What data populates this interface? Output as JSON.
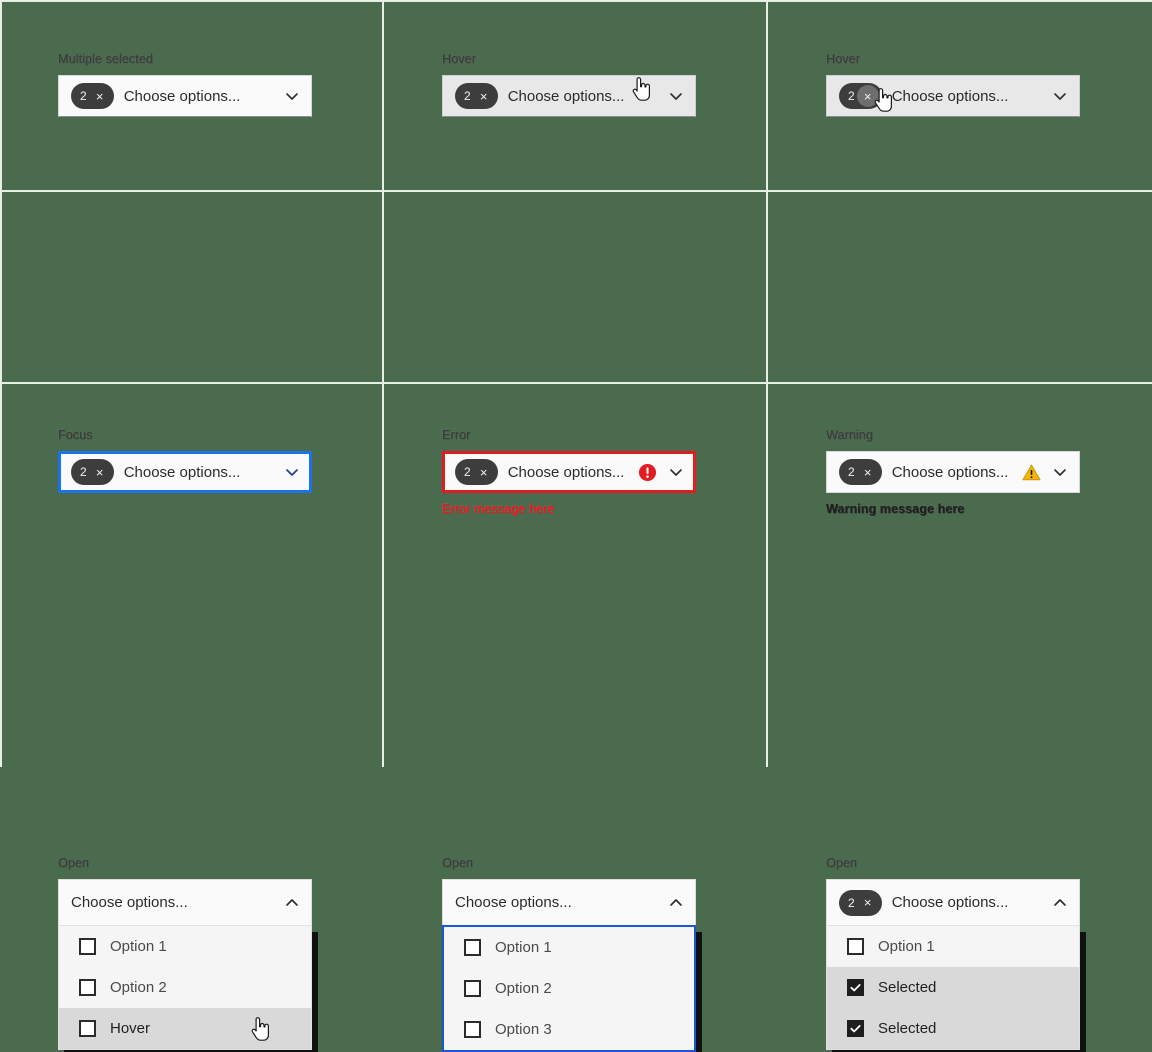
{
  "page": {
    "background_color": "#4a6b4e",
    "grid_line_color": "#e7efe7",
    "accent_focus": "#1a73e8",
    "accent_error": "#e11d22",
    "accent_warning": "#f5b60d",
    "chip_color": "#3d3d3d"
  },
  "common": {
    "placeholder": "Choose options...",
    "chip_count": "2",
    "chip_remove_glyph": "×",
    "chevron_down_icon": "chevron-down-icon",
    "chevron_up_icon": "chevron-up-icon"
  },
  "cells": [
    {
      "id": "multiple-selected",
      "label": "Multiple selected",
      "state": "default",
      "has_chip": true,
      "placeholder": "Choose options...",
      "chip_count": "2"
    },
    {
      "id": "hover-field",
      "label": "Hover",
      "state": "hover",
      "has_chip": true,
      "placeholder": "Choose options...",
      "chip_count": "2"
    },
    {
      "id": "hover-chip-remove",
      "label": "Hover",
      "state": "hover",
      "has_chip": true,
      "placeholder": "Choose options...",
      "chip_count": "2"
    },
    {
      "id": "focus",
      "label": "Focus",
      "state": "focus",
      "has_chip": true,
      "placeholder": "Choose options...",
      "chip_count": "2"
    },
    {
      "id": "error",
      "label": "Error",
      "state": "error",
      "has_chip": true,
      "placeholder": "Choose options...",
      "chip_count": "2",
      "message": "Error message here",
      "status_icon": "error-circle-icon"
    },
    {
      "id": "warning",
      "label": "Warning",
      "state": "warning",
      "has_chip": true,
      "placeholder": "Choose options...",
      "chip_count": "2",
      "message": "Warning message here",
      "status_icon": "warning-triangle-icon"
    },
    {
      "id": "open-hover-item",
      "label": "Open",
      "state": "open",
      "has_chip": false,
      "placeholder": "Choose options...",
      "options": [
        {
          "label": "Option 1",
          "checked": false,
          "hovered": false
        },
        {
          "label": "Option 2",
          "checked": false,
          "hovered": false
        },
        {
          "label": "Hover",
          "checked": false,
          "hovered": true
        }
      ]
    },
    {
      "id": "open-focus-menu",
      "label": "Open",
      "state": "open",
      "has_chip": false,
      "placeholder": "Choose options...",
      "menu_focused": true,
      "options": [
        {
          "label": "Option 1",
          "checked": false,
          "hovered": false
        },
        {
          "label": "Option 2",
          "checked": false,
          "hovered": false
        },
        {
          "label": "Option 3",
          "checked": false,
          "hovered": false
        }
      ]
    },
    {
      "id": "open-selected",
      "label": "Open",
      "state": "open",
      "has_chip": true,
      "chip_count": "2",
      "placeholder": "Choose options...",
      "options": [
        {
          "label": "Option 1",
          "checked": false,
          "hovered": false
        },
        {
          "label": "Selected",
          "checked": true,
          "hovered": false
        },
        {
          "label": "Selected",
          "checked": true,
          "hovered": false
        }
      ]
    }
  ]
}
